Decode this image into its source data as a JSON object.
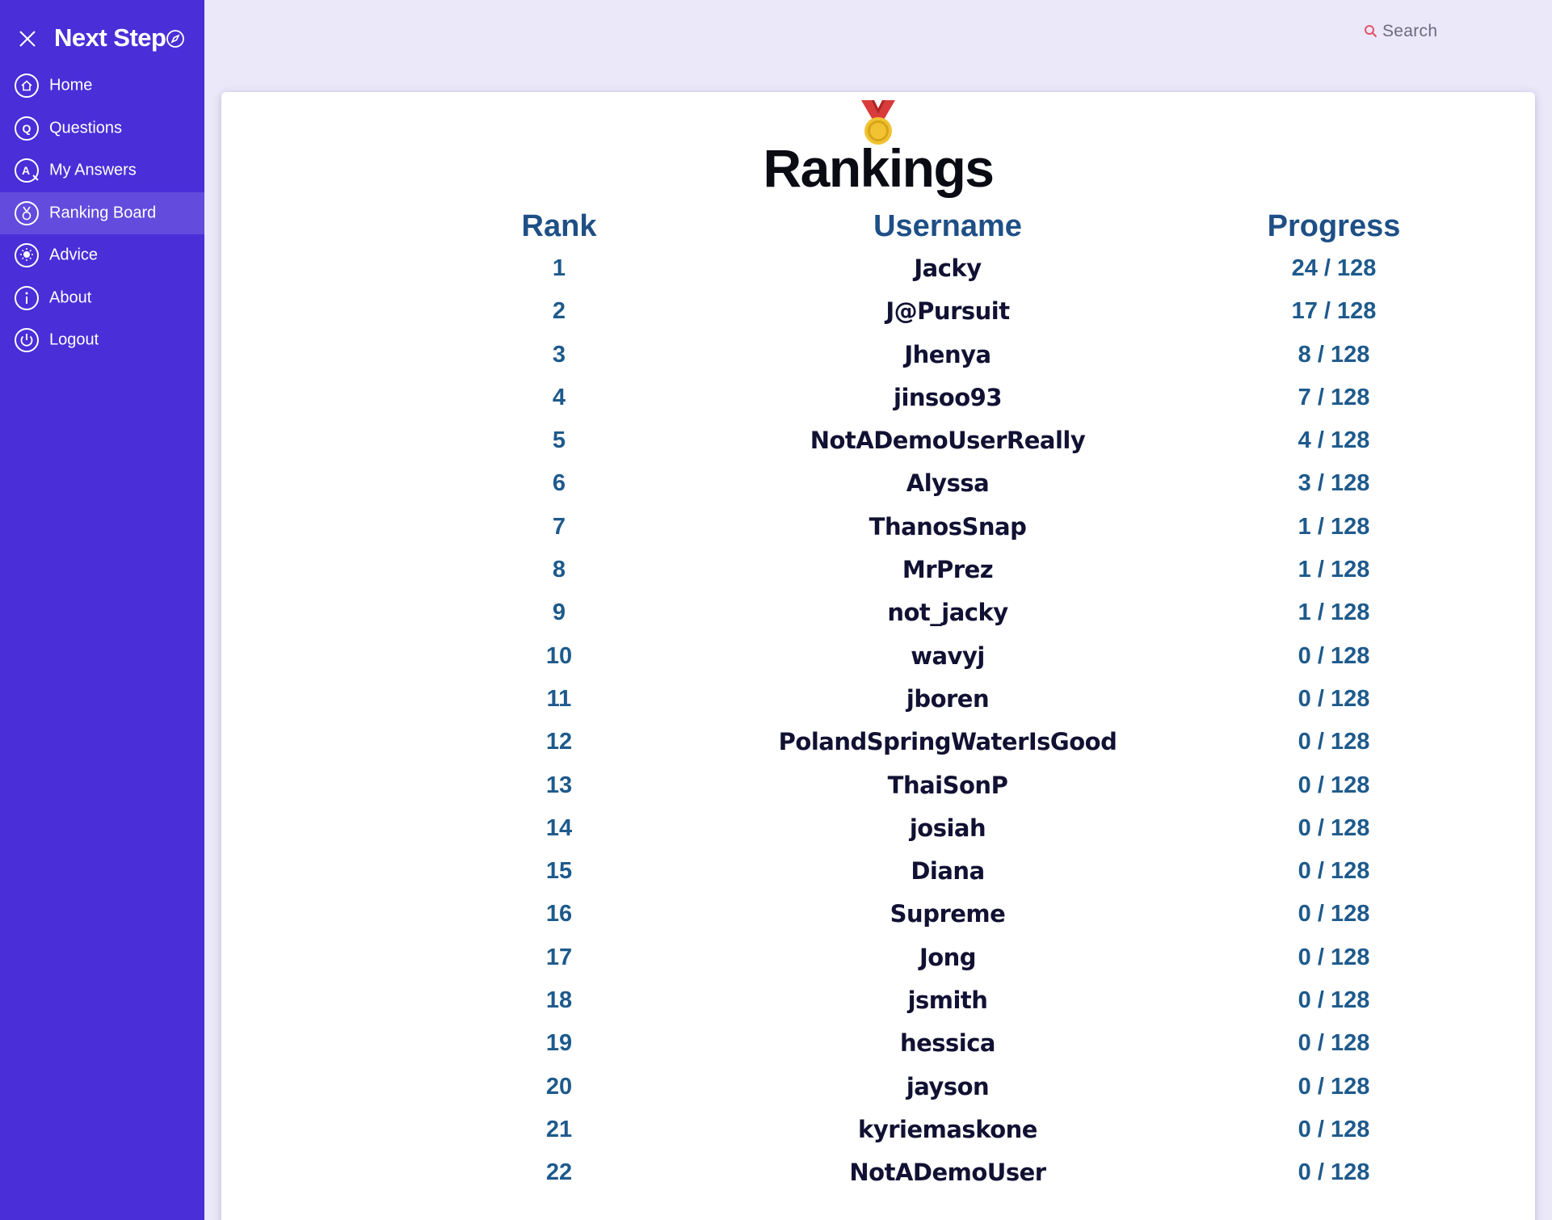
{
  "app": {
    "brand": "Next Step",
    "search_label": "Search"
  },
  "sidebar": {
    "items": [
      {
        "label": "Home",
        "icon": "home-icon",
        "active": false
      },
      {
        "label": "Questions",
        "icon": "question-icon",
        "active": false
      },
      {
        "label": "My Answers",
        "icon": "answers-icon",
        "active": false
      },
      {
        "label": "Ranking Board",
        "icon": "medal-icon",
        "active": true
      },
      {
        "label": "Advice",
        "icon": "lightbulb-icon",
        "active": false
      },
      {
        "label": "About",
        "icon": "info-icon",
        "active": false
      },
      {
        "label": "Logout",
        "icon": "power-icon",
        "active": false
      }
    ]
  },
  "main": {
    "title": "Rankings",
    "columns": [
      "Rank",
      "Username",
      "Progress"
    ],
    "rows": [
      {
        "rank": "1",
        "username": "Jacky",
        "progress": "24 / 128"
      },
      {
        "rank": "2",
        "username": "J@Pursuit",
        "progress": "17 / 128"
      },
      {
        "rank": "3",
        "username": "Jhenya",
        "progress": "8 / 128"
      },
      {
        "rank": "4",
        "username": "jinsoo93",
        "progress": "7 / 128"
      },
      {
        "rank": "5",
        "username": "NotADemoUserReally",
        "progress": "4 / 128"
      },
      {
        "rank": "6",
        "username": "Alyssa",
        "progress": "3 / 128"
      },
      {
        "rank": "7",
        "username": "ThanosSnap",
        "progress": "1 / 128"
      },
      {
        "rank": "8",
        "username": "MrPrez",
        "progress": "1 / 128"
      },
      {
        "rank": "9",
        "username": "not_jacky",
        "progress": "1 / 128"
      },
      {
        "rank": "10",
        "username": "wavyj",
        "progress": "0 / 128"
      },
      {
        "rank": "11",
        "username": "jboren",
        "progress": "0 / 128"
      },
      {
        "rank": "12",
        "username": "PolandSpringWaterIsGood",
        "progress": "0 / 128"
      },
      {
        "rank": "13",
        "username": "ThaiSonP",
        "progress": "0 / 128"
      },
      {
        "rank": "14",
        "username": "josiah",
        "progress": "0 / 128"
      },
      {
        "rank": "15",
        "username": "Diana",
        "progress": "0 / 128"
      },
      {
        "rank": "16",
        "username": "Supreme",
        "progress": "0 / 128"
      },
      {
        "rank": "17",
        "username": "Jong",
        "progress": "0 / 128"
      },
      {
        "rank": "18",
        "username": "jsmith",
        "progress": "0 / 128"
      },
      {
        "rank": "19",
        "username": "hessica",
        "progress": "0 / 128"
      },
      {
        "rank": "20",
        "username": "jayson",
        "progress": "0 / 128"
      },
      {
        "rank": "21",
        "username": "kyriemaskone",
        "progress": "0 / 128"
      },
      {
        "rank": "22",
        "username": "NotADemoUser",
        "progress": "0 / 128"
      }
    ]
  },
  "colors": {
    "sidebar_bg": "#4a2ed8",
    "page_bg": "#ebe8f9",
    "header_text": "#1e4f86",
    "rank_text": "#1e5a8c",
    "username_text": "#111133",
    "search_icon": "#e0566b"
  }
}
